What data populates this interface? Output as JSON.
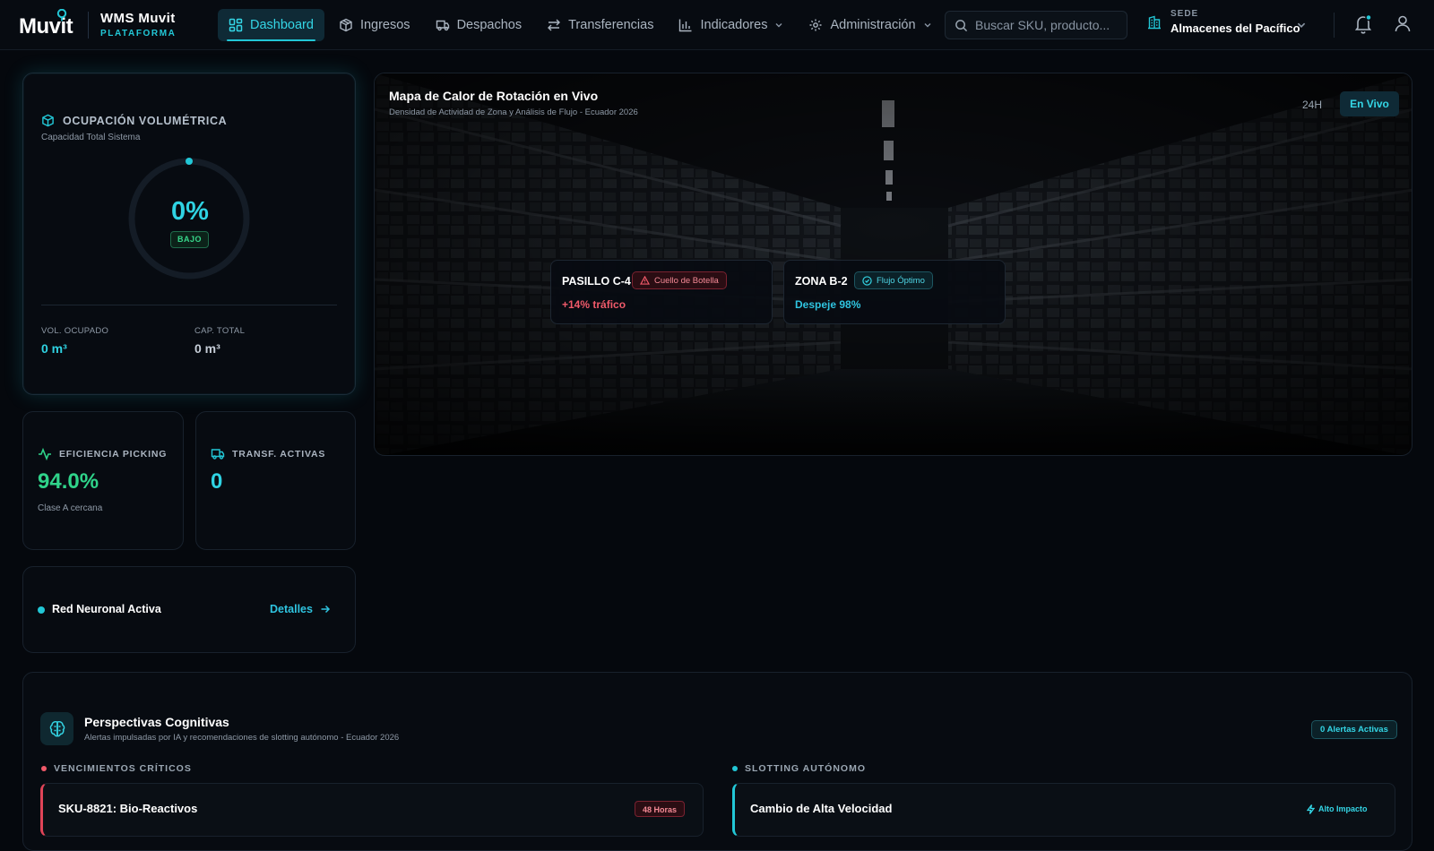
{
  "brand": {
    "logo": "Muvit",
    "title": "WMS Muvit",
    "subtitle": "PLATAFORMA",
    "accent": "#22c7d6"
  },
  "nav": {
    "items": [
      {
        "label": "Dashboard",
        "icon": "grid-icon",
        "active": true
      },
      {
        "label": "Ingresos",
        "icon": "package-icon"
      },
      {
        "label": "Despachos",
        "icon": "truck-icon"
      },
      {
        "label": "Transferencias",
        "icon": "arrows-icon"
      },
      {
        "label": "Indicadores",
        "icon": "bar-chart-icon",
        "dropdown": true
      },
      {
        "label": "Administración",
        "icon": "gear-icon",
        "dropdown": true
      }
    ]
  },
  "search": {
    "placeholder": "Buscar SKU, producto...",
    "value": ""
  },
  "sede": {
    "label": "SEDE",
    "value": "Almacenes del Pacífico"
  },
  "occupancy": {
    "title": "OCUPACIÓN VOLUMÉTRICA",
    "subtitle": "Capacidad Total Sistema",
    "percent": "0%",
    "level": "BAJO",
    "vol_label": "VOL. OCUPADO",
    "vol_value": "0 m³",
    "cap_label": "CAP. TOTAL",
    "cap_value": "0 m³"
  },
  "efficiency": {
    "title": "EFICIENCIA PICKING",
    "value": "94.0%",
    "note": "Clase A cercana",
    "color": "#2fd38a"
  },
  "transfers": {
    "title": "TRANSF. ACTIVAS",
    "value": "0",
    "color": "#2fd3e3"
  },
  "neural": {
    "title": "Red Neuronal Activa",
    "link": "Detalles"
  },
  "heatmap": {
    "title": "Mapa de Calor de Rotación en Vivo",
    "subtitle": "Densidad de Actividad de Zona y Análisis de Flujo - Ecuador 2026",
    "range": "24H",
    "live": "En Vivo",
    "zones": [
      {
        "name": "PASILLO C-4",
        "badge": "Cuello de Botella",
        "metric": "+14% tráfico",
        "color": "#f05a6a"
      },
      {
        "name": "ZONA B-2",
        "badge": "Flujo Óptimo",
        "metric": "Despeje 98%",
        "color": "#2fc4e0"
      }
    ]
  },
  "insights": {
    "title": "Perspectivas Cognitivas",
    "subtitle": "Alertas impulsadas por IA y recomendaciones de slotting autónomo - Ecuador 2026",
    "alerts": "0 Alertas Activas",
    "left_section": "VENCIMIENTOS CRÍTICOS",
    "left_item": "SKU-8821: Bio-Reactivos",
    "left_tag": "48 Horas",
    "right_section": "SLOTTING AUTÓNOMO",
    "right_item": "Cambio de Alta Velocidad",
    "right_tag": "Alto Impacto"
  }
}
